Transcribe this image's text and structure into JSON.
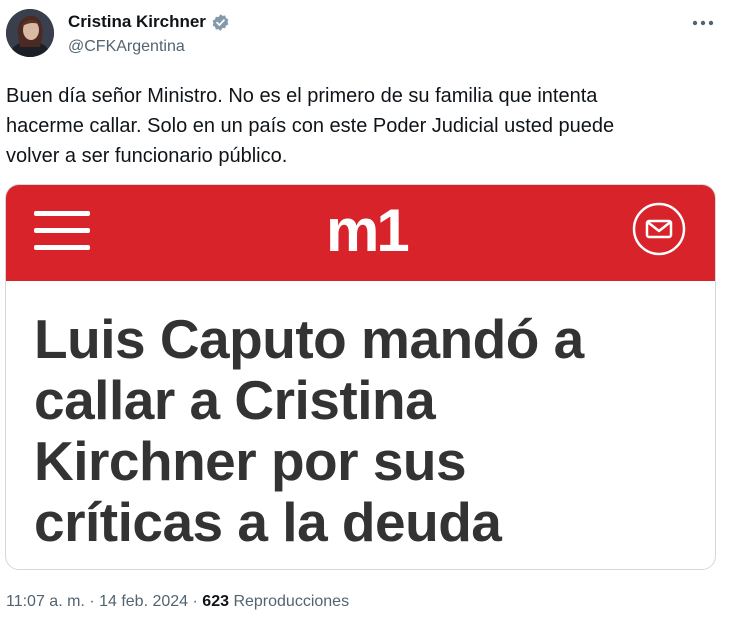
{
  "author": {
    "display_name": "Cristina Kirchner",
    "handle": "@CFKArgentina",
    "verified_icon": "verified-badge-icon",
    "verified_color": "#829aab"
  },
  "tweet": {
    "text_lines": [
      "Buen día señor Ministro. No es el primero de su familia que intenta",
      "hacerme callar. Solo en un país con este Poder Judicial usted puede",
      "volver a ser funcionario público."
    ]
  },
  "media": {
    "brand_logo": "m1",
    "brand_color": "#d8232a",
    "menu_icon": "hamburger-icon",
    "contact_icon": "mail-icon",
    "headline_lines": [
      "Luis Caputo mandó a",
      "callar a Cristina",
      "Kirchner por sus",
      "críticas a la deuda"
    ]
  },
  "meta": {
    "time": "11:07 a. m.",
    "separator": "·",
    "date": "14 feb. 2024",
    "views_count": "623",
    "views_label": "Reproducciones"
  }
}
